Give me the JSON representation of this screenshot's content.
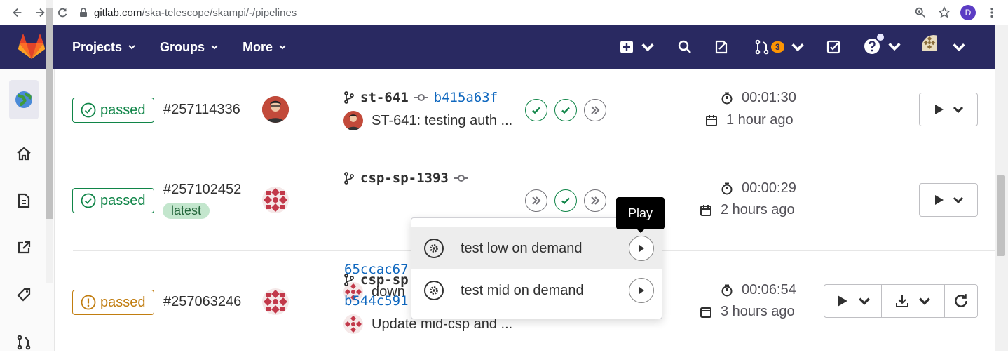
{
  "browser": {
    "url_host": "gitlab.com",
    "url_path": "/ska-telescope/skampi/-/pipelines",
    "profile_initial": "D"
  },
  "header": {
    "nav": [
      {
        "label": "Projects"
      },
      {
        "label": "Groups"
      },
      {
        "label": "More"
      }
    ],
    "merge_requests_count": "3"
  },
  "pipelines": [
    {
      "status": "passed",
      "id": "#257114336",
      "latest": "",
      "ref": "st-641",
      "sha": "b415a63f",
      "commit_title": "ST-641: testing auth ...",
      "stages": [
        "success",
        "success",
        "skipped"
      ],
      "duration": "00:01:30",
      "finished": "1 hour ago"
    },
    {
      "status": "passed",
      "id": "#257102452",
      "latest": "latest",
      "ref": "csp-sp-1393",
      "sha": "65ccac67",
      "commit_title": "down",
      "stages": [
        "skipped",
        "success",
        "skipped"
      ],
      "duration": "00:00:29",
      "finished": "2 hours ago"
    },
    {
      "status": "passed",
      "id": "#257063246",
      "latest": "",
      "ref": "csp-sp",
      "sha": "b544c591",
      "commit_title": "Update mid-csp and ...",
      "stages": [],
      "duration": "00:06:54",
      "finished": "3 hours ago"
    }
  ],
  "dropdown": {
    "items": [
      {
        "label": "test low on demand"
      },
      {
        "label": "test mid on demand"
      }
    ]
  },
  "tooltip": {
    "text": "Play"
  },
  "colors": {
    "header_bg": "#292961",
    "success": "#108548",
    "warning": "#c17d10",
    "link": "#1068bf",
    "badge": "#fc9403"
  }
}
